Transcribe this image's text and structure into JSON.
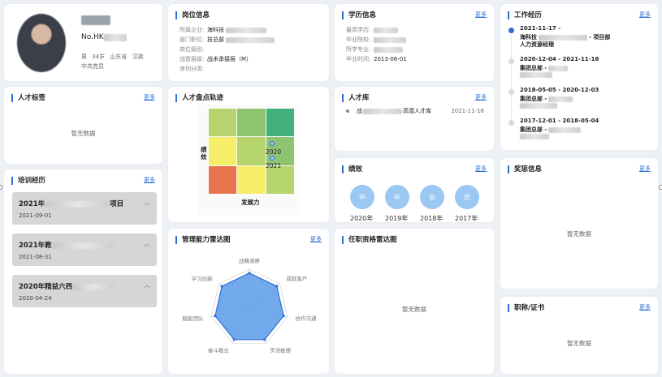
{
  "profile": {
    "code": "No.HK",
    "gender": "男",
    "age": "34岁",
    "origin": "山东省",
    "ethnicity": "汉族",
    "party": "中共党员"
  },
  "position": {
    "title": "岗位信息",
    "rows": [
      {
        "k": "所属企业:",
        "v": "海科技"
      },
      {
        "k": "部门职位:",
        "v": "技总部"
      },
      {
        "k": "岗位级别:",
        "v": ""
      },
      {
        "k": "战管层级:",
        "v": "战术承接层（M）"
      },
      {
        "k": "序列分类:",
        "v": ""
      }
    ]
  },
  "education": {
    "title": "学历信息",
    "more": "更多",
    "rows": [
      {
        "k": "最高学历:",
        "v": ""
      },
      {
        "k": "毕业院校:",
        "v": ""
      },
      {
        "k": "所学专业:",
        "v": ""
      },
      {
        "k": "毕业时间:",
        "v": "2013-06-01"
      }
    ]
  },
  "work": {
    "title": "工作经历",
    "more": "更多",
    "items": [
      {
        "date": "2021-11-17 -",
        "company": "海科技",
        "position": "人力资源经理",
        "suffix": "- 项目部",
        "active": true
      },
      {
        "date": "2020-12-04 - 2021-11-16",
        "company": "集团总部 -",
        "position": "",
        "suffix": "",
        "active": false
      },
      {
        "date": "2018-05-05 - 2020-12-03",
        "company": "集团总部 -",
        "position": "",
        "suffix": "",
        "active": false
      },
      {
        "date": "2017-12-01 - 2018-05-04",
        "company": "集团总部 -",
        "position": "",
        "suffix": "",
        "active": false
      }
    ]
  },
  "tags": {
    "title": "人才标签",
    "more": "更多",
    "empty": "暂无数据"
  },
  "track": {
    "title": "人才盘点轨迹",
    "ylabel": "绩效",
    "xlabel": "发展力",
    "points": [
      "2020",
      "2021"
    ],
    "grid_colors": [
      "#b5d46d",
      "#8ec470",
      "#41b07a",
      "#f7ee6a",
      "#b5d46d",
      "#8ec470",
      "#e9744e",
      "#f7ee6a",
      "#b5d46d"
    ]
  },
  "pool": {
    "title": "人才库",
    "more": "更多",
    "name": "战",
    "name_suffix": "高潜人才库",
    "date": "2021-11-16"
  },
  "performance": {
    "title": "绩效",
    "more": "更多",
    "items": [
      {
        "grade": "中",
        "year": "2020年"
      },
      {
        "grade": "中",
        "year": "2019年"
      },
      {
        "grade": "良",
        "year": "2018年"
      },
      {
        "grade": "优",
        "year": "2017年"
      }
    ]
  },
  "training": {
    "title": "培训经历",
    "more": "更多",
    "items": [
      {
        "title": "2021年",
        "title_suffix": "项目",
        "date": "2021-09-01"
      },
      {
        "title": "2021年教",
        "title_suffix": "",
        "date": "2021-08-31"
      },
      {
        "title": "2020年精益六西",
        "title_suffix": "",
        "date": "2020-04-24"
      }
    ]
  },
  "radar": {
    "title": "管理能力雷达图",
    "more": "更多",
    "labels": [
      "战略洞察",
      "成就客户",
      "协作沟通",
      "灵活敏捷",
      "奋斗敬业",
      "赋能团队",
      "学习创新"
    ],
    "values": [
      0.9,
      0.9,
      0.9,
      0.9,
      0.9,
      0.9,
      0.9
    ]
  },
  "qualification_radar": {
    "title": "任职资格雷达图",
    "empty": "暂无数据"
  },
  "awards": {
    "title": "奖惩信息",
    "more": "更多",
    "empty": "暂无数据"
  },
  "certs": {
    "title": "职称/证书",
    "more": "更多",
    "empty": "暂无数据"
  },
  "colors": {
    "accent": "#2e6fd8",
    "perf_circle": "#9bc7f3",
    "radar_fill": "#5b9be8"
  }
}
